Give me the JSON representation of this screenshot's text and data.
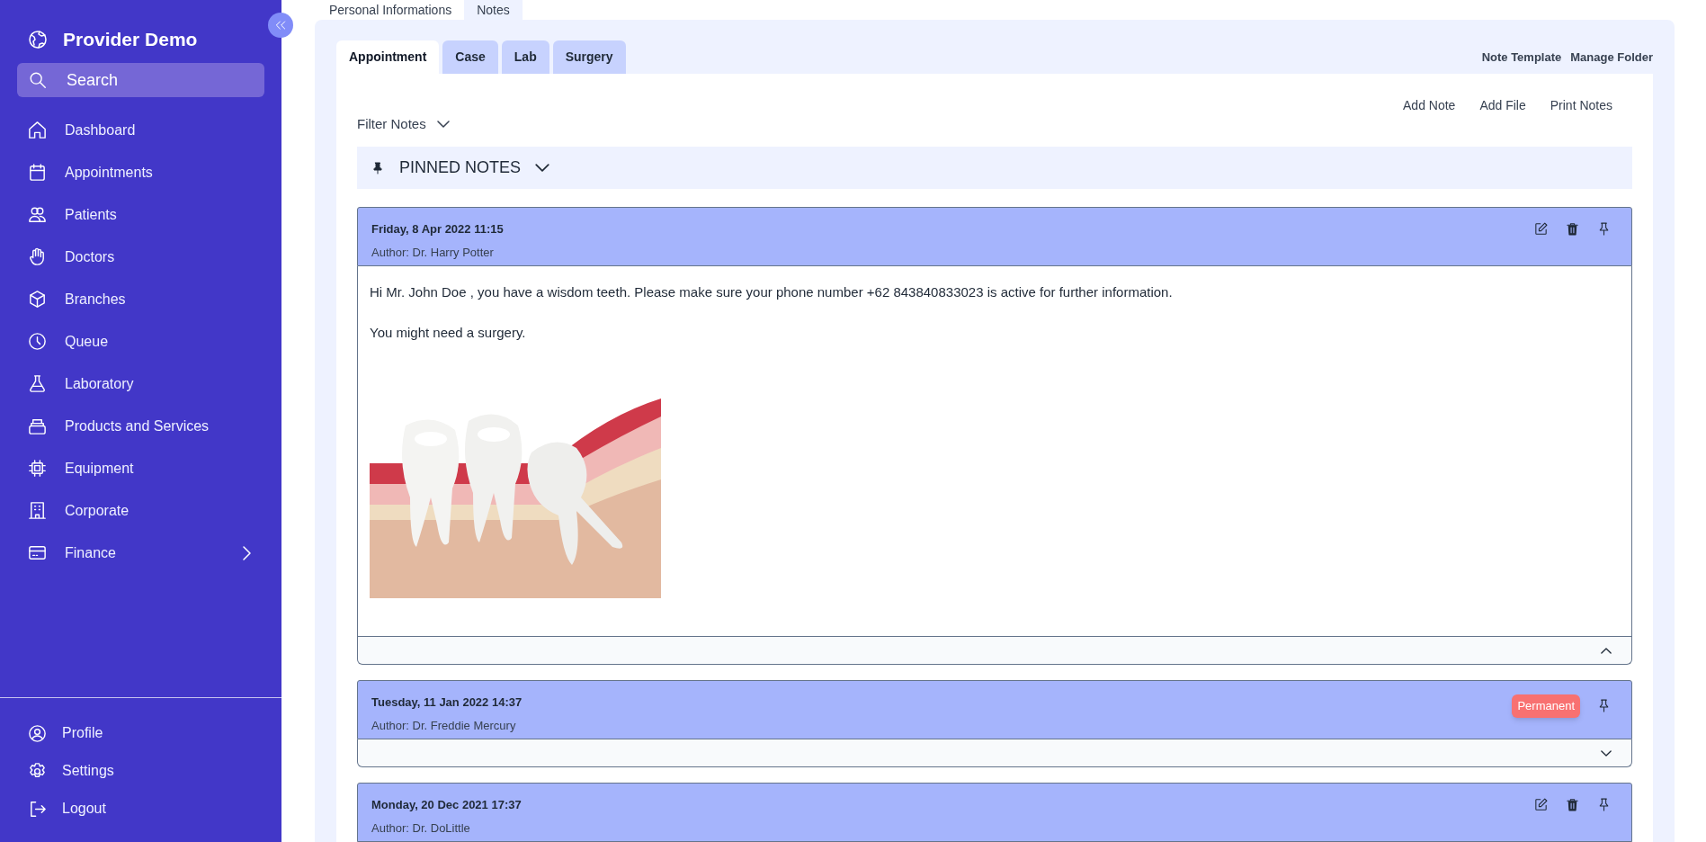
{
  "sidebar": {
    "brand": "Provider Demo",
    "search": {
      "placeholder": "Search"
    },
    "items": [
      {
        "label": "Dashboard",
        "expandable": false
      },
      {
        "label": "Appointments",
        "expandable": false
      },
      {
        "label": "Patients",
        "expandable": false
      },
      {
        "label": "Doctors",
        "expandable": false
      },
      {
        "label": "Branches",
        "expandable": false
      },
      {
        "label": "Queue",
        "expandable": false
      },
      {
        "label": "Laboratory",
        "expandable": false
      },
      {
        "label": "Products and Services",
        "expandable": false
      },
      {
        "label": "Equipment",
        "expandable": false
      },
      {
        "label": "Corporate",
        "expandable": false
      },
      {
        "label": "Finance",
        "expandable": true
      }
    ],
    "bottom_items": [
      {
        "label": "Profile"
      },
      {
        "label": "Settings"
      },
      {
        "label": "Logout"
      }
    ]
  },
  "top_tabs": [
    {
      "label": "Personal Informations",
      "selected": false
    },
    {
      "label": "Notes",
      "selected": true
    }
  ],
  "note_tabs": [
    {
      "label": "Appointment",
      "selected": true
    },
    {
      "label": "Case",
      "selected": false
    },
    {
      "label": "Lab",
      "selected": false
    },
    {
      "label": "Surgery",
      "selected": false
    }
  ],
  "header_links": [
    "Note Template",
    "Manage Folder"
  ],
  "actions": [
    "Add Note",
    "Add File",
    "Print Notes"
  ],
  "filter": {
    "label": "Filter Notes"
  },
  "pinned_section": {
    "label": "PINNED NOTES"
  },
  "notes": [
    {
      "date": "Friday, 8 Apr 2022 11:15",
      "author": "Author: Dr. Harry Potter",
      "editable": true,
      "expanded": true,
      "paragraphs": [
        "Hi Mr. John Doe , you have a wisdom teeth. Please make sure your phone number +62 843840833023 is active for further information.",
        "You might need a surgery."
      ],
      "attachment": {
        "kind": "picture"
      }
    },
    {
      "date": "Tuesday, 11 Jan 2022 14:37",
      "author": "Author: Dr. Freddie Mercury",
      "editable": false,
      "badge": "Permanent",
      "expanded": false
    },
    {
      "date": "Monday, 20 Dec 2021 17:37",
      "author": "Author: Dr. DoLittle",
      "editable": true
    }
  ]
}
